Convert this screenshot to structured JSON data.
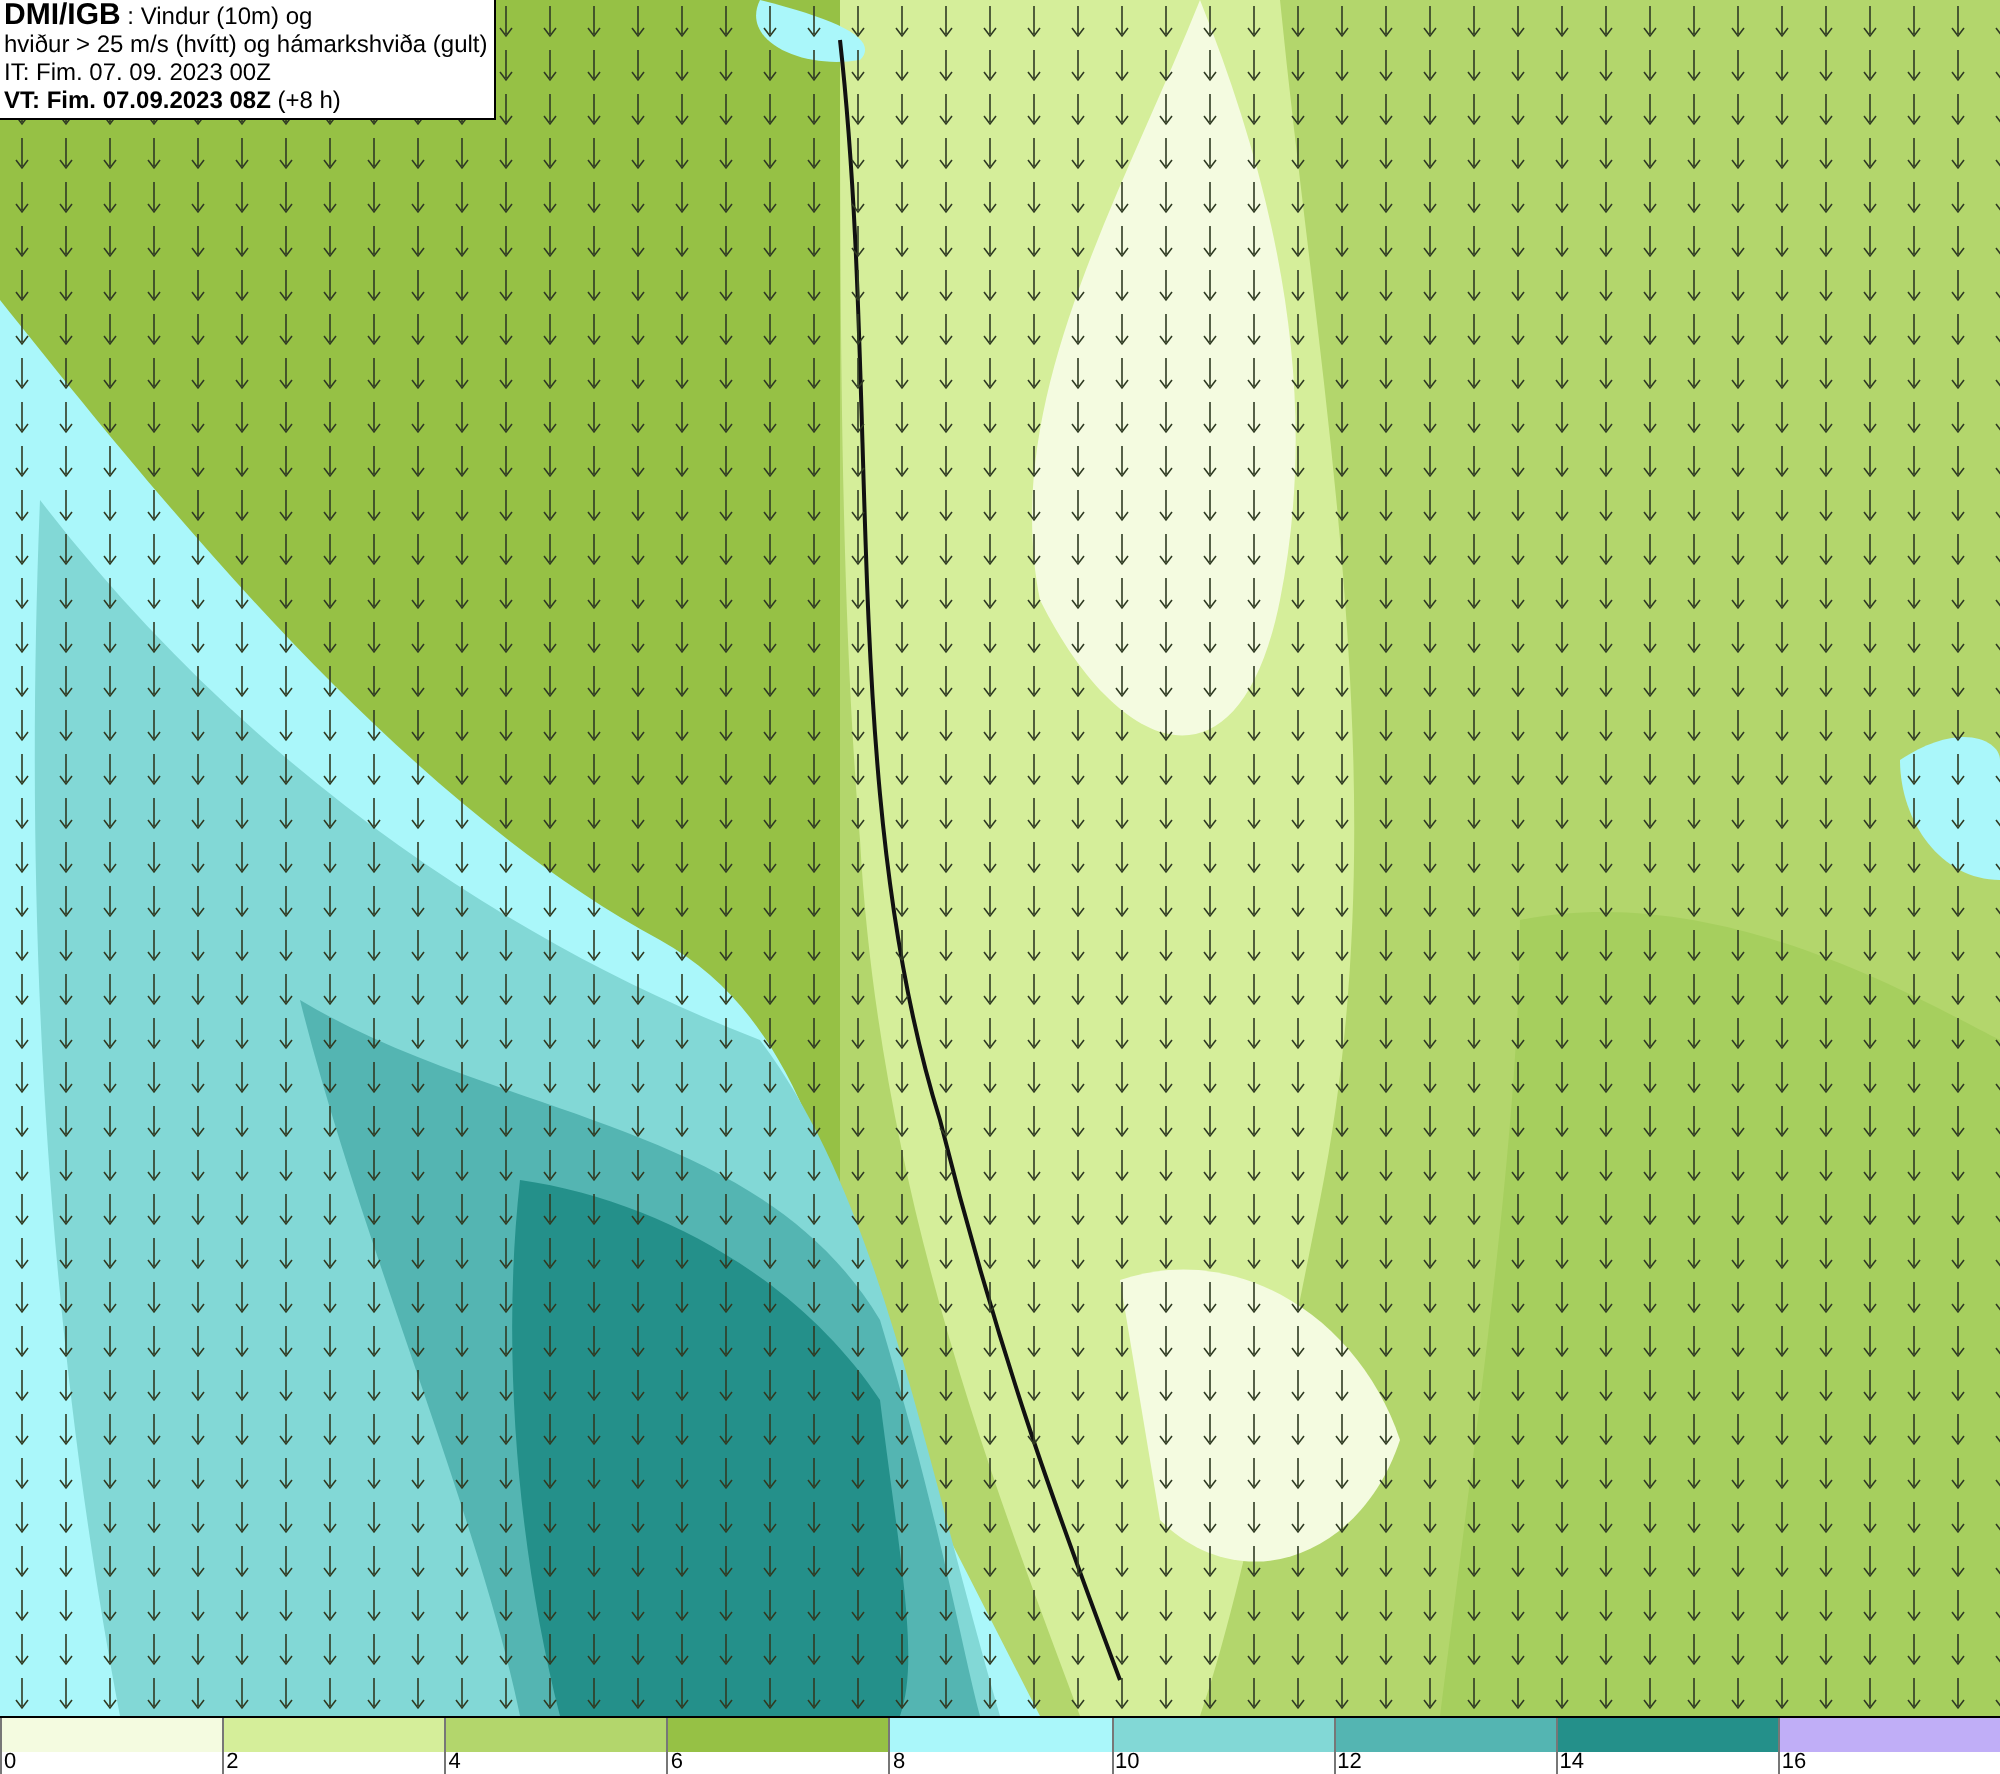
{
  "header": {
    "lines": [
      "**DMI/IGB** : Vindur (10m) og",
      "hviður > 25 m/s (hvítt) og hámarkshviða (gult)",
      "IT: Fim. 07. 09. 2023 00Z",
      "**VT: Fim. 07.09.2023 08Z** (+8 h)"
    ]
  },
  "legend": [
    {
      "label": "0",
      "color": "#f4fbe0"
    },
    {
      "label": "2",
      "color": "#d5ee9a"
    },
    {
      "label": "4",
      "color": "#b3d66c"
    },
    {
      "label": "6",
      "color": "#96c145"
    },
    {
      "label": "8",
      "color": "#aaf7fa"
    },
    {
      "label": "10",
      "color": "#82d8d6"
    },
    {
      "label": "12",
      "color": "#54b5b2"
    },
    {
      "label": "14",
      "color": "#24908a"
    },
    {
      "label": "16",
      "color": "#c0aef7"
    }
  ]
}
